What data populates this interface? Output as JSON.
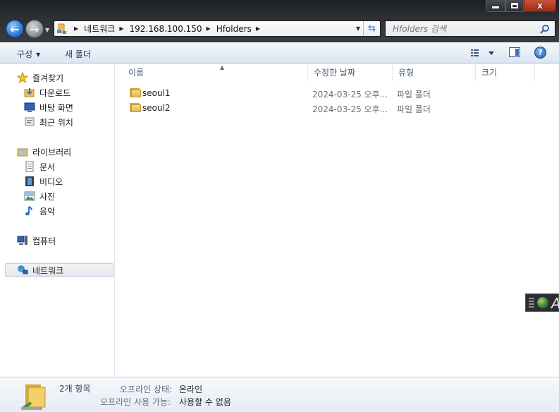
{
  "window": {
    "minimize_icon": "minimize-icon",
    "maximize_icon": "maximize-icon",
    "close_icon": "close-icon",
    "close_glyph": "x"
  },
  "address": {
    "crumbs": [
      "네트워크",
      "192.168.100.150",
      "Hfolders"
    ],
    "search_placeholder": "Hfolders 검색"
  },
  "toolbar": {
    "organize": "구성",
    "new_folder": "새 폴더"
  },
  "nav": {
    "favorites": "즐겨찾기",
    "downloads": "다운로드",
    "desktop": "바탕 화면",
    "recent": "최근 위치",
    "libraries": "라이브러리",
    "documents": "문서",
    "videos": "비디오",
    "pictures": "사진",
    "music": "음악",
    "computer": "컴퓨터",
    "network": "네트워크"
  },
  "columns": {
    "name": "이름",
    "modified": "수정한 날짜",
    "type": "유형",
    "size": "크기"
  },
  "files": [
    {
      "name": "seoul1",
      "modified": "2024-03-25 오후...",
      "type": "파일 폴더"
    },
    {
      "name": "seoul2",
      "modified": "2024-03-25 오후...",
      "type": "파일 폴더"
    }
  ],
  "details": {
    "count": "2개 항목",
    "offline_status_label": "오프라인 상태:",
    "offline_status_value": "온라인",
    "offline_avail_label": "오프라인 사용 가능:",
    "offline_avail_value": "사용할 수 없음"
  },
  "widget": {
    "letter": "A"
  },
  "colors": {
    "accent": "#1e395b",
    "title_bar": "#2c2f33",
    "folder": "#e3b850"
  }
}
